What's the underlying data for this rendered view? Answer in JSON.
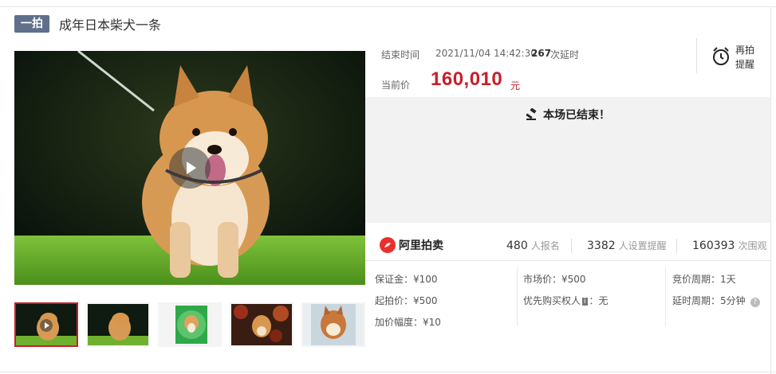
{
  "header": {
    "tag": "一拍",
    "title": "成年日本柴犬一条"
  },
  "auction": {
    "end_label": "结束时间",
    "end_time": "2021/11/04 14:42:30",
    "delay_count": "267",
    "delay_text": "次延时",
    "current_price_label": "当前价",
    "current_price": "160,010",
    "currency_unit": "元",
    "remind_label": "再拍\n提醒",
    "ended_message": "本场已结束！"
  },
  "stats": {
    "platform": "阿里拍卖",
    "signups_value": "480",
    "signups_label": "人报名",
    "reminders_value": "3382",
    "reminders_label": "人设置提醒",
    "watchers_value": "160393",
    "watchers_label": "次围观"
  },
  "details": {
    "deposit": "保证金：¥100",
    "start_price": "起拍价：¥500",
    "increment": "加价幅度：¥10",
    "market_price": "市场价：¥500",
    "priority_prefix": "优先购买权人",
    "priority_badge": "i",
    "priority_suffix": "：无",
    "bid_period": "竞价周期：1天",
    "delay_period": "延时周期：5分钟"
  },
  "gallery": {
    "thumb_count": 5,
    "active_index": 0
  },
  "colors": {
    "accent_red": "#c7202b",
    "tag_bg": "#5f6f8c",
    "ended_bg": "#f2f2f2"
  }
}
